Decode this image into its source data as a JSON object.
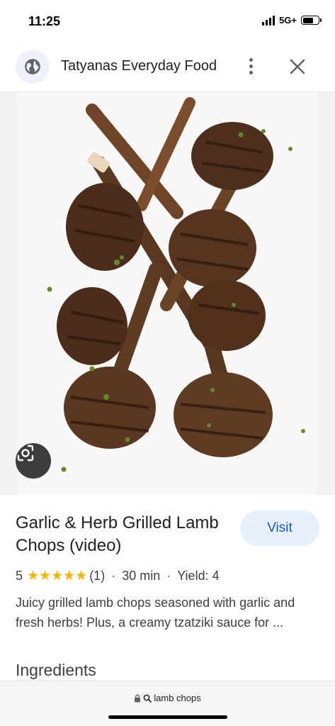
{
  "status_bar": {
    "time": "11:25",
    "network": "5G+",
    "signal_icon": "cellular-signal-icon",
    "battery_icon": "battery-icon"
  },
  "header": {
    "site_name": "Tatyanas Everyday Food",
    "globe_icon": "globe-icon",
    "more_icon": "more-vert-icon",
    "close_icon": "close-icon"
  },
  "image": {
    "lens_icon": "lens-search-icon"
  },
  "result": {
    "title": "Garlic & Herb Grilled Lamb Chops (video)",
    "visit_label": "Visit",
    "rating": "5",
    "stars": "★★★★★",
    "review_count": "(1)",
    "separator": "·",
    "time": "30 min",
    "yield": "Yield: 4",
    "snippet": "Juicy grilled lamb chops seasoned with garlic and fresh herbs! Plus, a creamy tzatziki sauce for ...",
    "ingredients_heading": "Ingredients"
  },
  "bottom_bar": {
    "lock_icon": "lock-icon",
    "search_icon": "search-icon",
    "query": "lamb chops"
  },
  "colors": {
    "accent": "#1a56b8",
    "visit_bg": "#e8f0fe",
    "star": "#f4b400"
  }
}
